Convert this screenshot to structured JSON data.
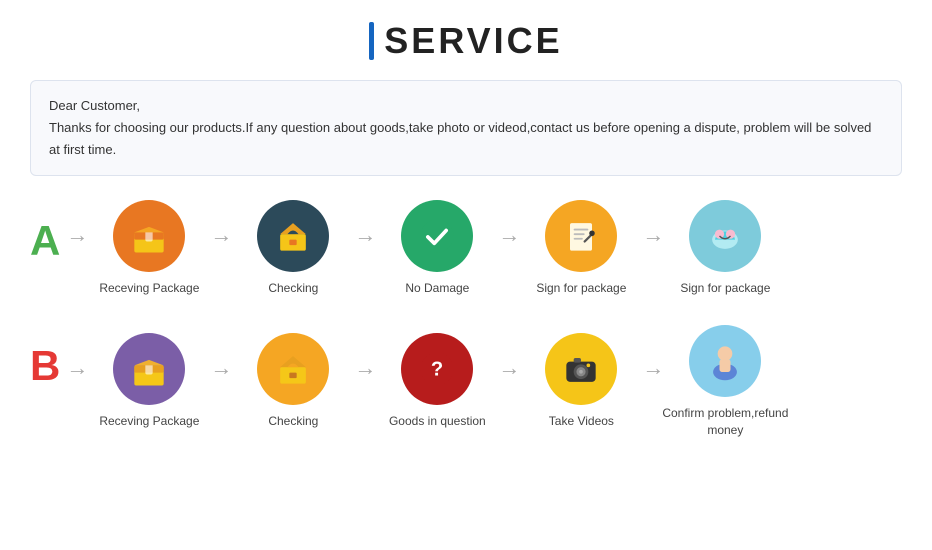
{
  "header": {
    "title": "SERVICE",
    "title_bar": "|"
  },
  "notice": {
    "line1": "Dear Customer,",
    "line2": "Thanks for choosing our products.If any question about goods,take photo or videod,contact us before opening a dispute, problem will be solved at first time."
  },
  "section_a": {
    "letter": "A",
    "steps": [
      {
        "label": "Receving Package",
        "icon": "box-orange",
        "bg": "bg-orange"
      },
      {
        "label": "Checking",
        "icon": "box-open-teal",
        "bg": "bg-dark-teal"
      },
      {
        "label": "No Damage",
        "icon": "checkmark-green",
        "bg": "bg-green"
      },
      {
        "label": "Sign for package",
        "icon": "sign-amber",
        "bg": "bg-amber"
      },
      {
        "label": "Sign for package",
        "icon": "handshake-blue",
        "bg": "bg-light-blue"
      }
    ]
  },
  "section_b": {
    "letter": "B",
    "steps": [
      {
        "label": "Receving Package",
        "icon": "box-purple",
        "bg": "bg-purple"
      },
      {
        "label": "Checking",
        "icon": "box-open-amber",
        "bg": "bg-amber2"
      },
      {
        "label": "Goods in question",
        "icon": "question-red",
        "bg": "bg-red-dark"
      },
      {
        "label": "Take Videos",
        "icon": "camera-yellow",
        "bg": "bg-yellow"
      },
      {
        "label": "Confirm problem,refund money",
        "icon": "person-sky",
        "bg": "bg-sky"
      }
    ]
  },
  "arrow": "→"
}
